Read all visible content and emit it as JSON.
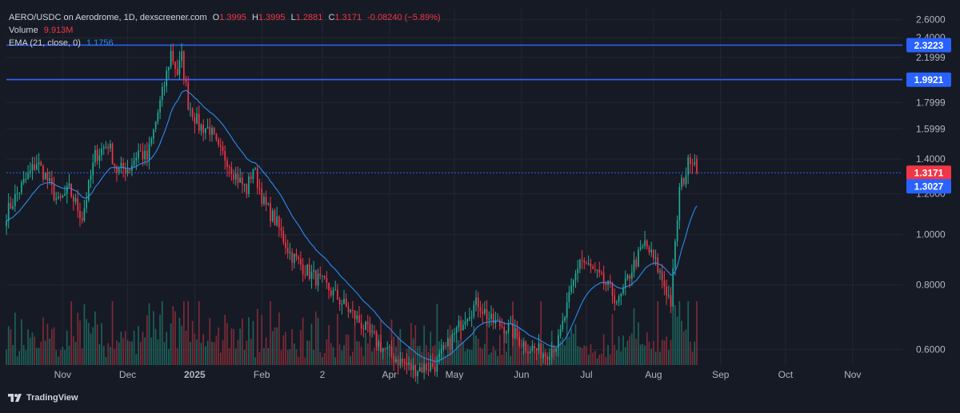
{
  "header": {
    "symbol": "AERO/USDC on Aerodrome, 1D, dexscreener.com",
    "o_label": "O",
    "o_value": "1.3995",
    "h_label": "H",
    "h_value": "1.3995",
    "l_label": "L",
    "l_value": "1.2881",
    "c_label": "C",
    "c_value": "1.3171",
    "change": "-0.08240 (−5.89%)",
    "volume_label": "Volume",
    "volume_value": "9.913M",
    "ema_label": "EMA (21, close, 0)",
    "ema_value": "1.1756"
  },
  "footer": {
    "brand": "TradingView"
  },
  "colors": {
    "background": "#161a25",
    "up": "#22ab94",
    "down": "#f23645",
    "up_volume": "#1f6f62",
    "down_volume": "#8e2f39",
    "ema": "#2a8cf0",
    "hline": "#2962ff",
    "text": "#b2b5be"
  },
  "chart_data": {
    "type": "candlestick",
    "y_scale": "log",
    "ylim": [
      0.56,
      2.72
    ],
    "y_ticks": [
      "2.6000",
      "2.4000",
      "2.1999",
      "1.9999",
      "1.7999",
      "1.5999",
      "1.4000",
      "1.2000",
      "1.0000",
      "0.8000",
      "0.6000"
    ],
    "x_ticks": [
      "Nov",
      "Dec",
      "2025",
      "Feb",
      "2",
      "Apr",
      "May",
      "Jun",
      "Jul",
      "Aug",
      "Sep",
      "Oct",
      "Nov"
    ],
    "horizontal_lines": [
      {
        "value": 2.3223,
        "label": "2.3223"
      },
      {
        "value": 1.9921,
        "label": "1.9921"
      },
      {
        "value": 1.3171,
        "label": "1.3171",
        "style": "dotted"
      }
    ],
    "price_labels": [
      {
        "value": 1.3171,
        "label": "1.3171",
        "kind": "last"
      },
      {
        "value": 1.3027,
        "label": "1.3027",
        "kind": "ema"
      }
    ],
    "close_series": {
      "start": "2024-10-06",
      "interval": "1D",
      "end": "2025-08-21",
      "anchors": [
        [
          "2024-10-06",
          1.1
        ],
        [
          "2024-10-12",
          1.22
        ],
        [
          "2024-10-20",
          1.38
        ],
        [
          "2024-10-24",
          1.3
        ],
        [
          "2024-10-30",
          1.15
        ],
        [
          "2024-11-04",
          1.22
        ],
        [
          "2024-11-10",
          1.08
        ],
        [
          "2024-11-16",
          1.42
        ],
        [
          "2024-11-22",
          1.5
        ],
        [
          "2024-11-26",
          1.33
        ],
        [
          "2024-12-02",
          1.35
        ],
        [
          "2024-12-06",
          1.45
        ],
        [
          "2024-12-10",
          1.4
        ],
        [
          "2024-12-14",
          1.65
        ],
        [
          "2024-12-18",
          1.95
        ],
        [
          "2024-12-21",
          2.25
        ],
        [
          "2024-12-24",
          2.05
        ],
        [
          "2024-12-26",
          2.2
        ],
        [
          "2024-12-29",
          1.8
        ],
        [
          "2025-01-03",
          1.62
        ],
        [
          "2025-01-08",
          1.6
        ],
        [
          "2025-01-12",
          1.45
        ],
        [
          "2025-01-16",
          1.4
        ],
        [
          "2025-01-20",
          1.3
        ],
        [
          "2025-01-25",
          1.22
        ],
        [
          "2025-01-28",
          1.35
        ],
        [
          "2025-02-02",
          1.15
        ],
        [
          "2025-02-08",
          1.05
        ],
        [
          "2025-02-14",
          0.92
        ],
        [
          "2025-02-22",
          0.85
        ],
        [
          "2025-03-02",
          0.8
        ],
        [
          "2025-03-10",
          0.74
        ],
        [
          "2025-03-18",
          0.68
        ],
        [
          "2025-03-26",
          0.62
        ],
        [
          "2025-04-03",
          0.58
        ],
        [
          "2025-04-12",
          0.55
        ],
        [
          "2025-04-22",
          0.56
        ],
        [
          "2025-04-30",
          0.63
        ],
        [
          "2025-05-06",
          0.7
        ],
        [
          "2025-05-12",
          0.74
        ],
        [
          "2025-05-18",
          0.68
        ],
        [
          "2025-05-26",
          0.66
        ],
        [
          "2025-06-03",
          0.61
        ],
        [
          "2025-06-12",
          0.59
        ],
        [
          "2025-06-18",
          0.62
        ],
        [
          "2025-06-24",
          0.78
        ],
        [
          "2025-06-28",
          0.9
        ],
        [
          "2025-07-04",
          0.85
        ],
        [
          "2025-07-10",
          0.8
        ],
        [
          "2025-07-16",
          0.74
        ],
        [
          "2025-07-22",
          0.86
        ],
        [
          "2025-07-28",
          0.96
        ],
        [
          "2025-08-02",
          0.88
        ],
        [
          "2025-08-06",
          0.8
        ],
        [
          "2025-08-09",
          0.74
        ],
        [
          "2025-08-11",
          0.95
        ],
        [
          "2025-08-13",
          1.22
        ],
        [
          "2025-08-16",
          1.32
        ],
        [
          "2025-08-18",
          1.42
        ],
        [
          "2025-08-20",
          1.39
        ],
        [
          "2025-08-21",
          1.3171
        ]
      ]
    }
  }
}
